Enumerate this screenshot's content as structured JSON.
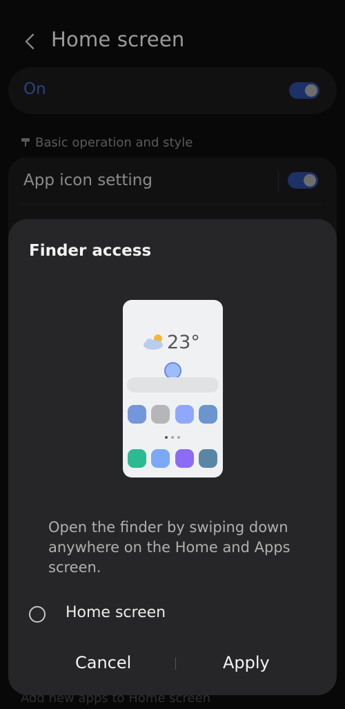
{
  "header": {
    "title": "Home screen",
    "back_icon": "chevron-left-icon"
  },
  "master_switch": {
    "label": "On",
    "state": true,
    "accent": "#3f66c9"
  },
  "section": {
    "title": "Basic operation and style",
    "icon": "pin-icon"
  },
  "settings_rows": [
    {
      "label": "App icon setting",
      "toggle": true
    }
  ],
  "dialog": {
    "title": "Finder access",
    "preview": {
      "temperature": "23°",
      "weather_icon": "partly-cloudy-icon",
      "app_colors_row1": [
        "#7397da",
        "#b6b6b8",
        "#8fa8fd",
        "#6a95cf"
      ],
      "app_colors_row2": [
        "#2dba92",
        "#7aa9f7",
        "#8c6cf4",
        "#5a86a6"
      ]
    },
    "description": "Open the finder by swiping down anywhere on the Home and Apps screen.",
    "option": {
      "label": "Home screen",
      "selected": false
    },
    "cancel_label": "Cancel",
    "apply_label": "Apply"
  },
  "peek_text": "Add new apps to Home screen"
}
